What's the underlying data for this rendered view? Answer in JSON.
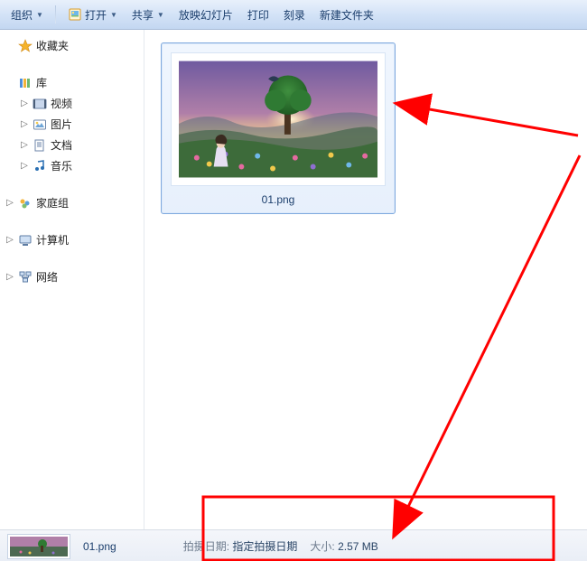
{
  "toolbar": {
    "organize": "组织",
    "open": "打开",
    "share": "共享",
    "slideshow": "放映幻灯片",
    "print": "打印",
    "burn": "刻录",
    "new_folder": "新建文件夹"
  },
  "sidebar": {
    "favorites": "收藏夹",
    "libraries": "库",
    "videos": "视频",
    "pictures": "图片",
    "documents": "文档",
    "music": "音乐",
    "homegroup": "家庭组",
    "computer": "计算机",
    "network": "网络"
  },
  "file": {
    "name": "01.png",
    "date_label": "拍摄日期:",
    "date_value": "指定拍摄日期",
    "size_label": "大小:",
    "size_value": "2.57 MB"
  },
  "colors": {
    "annotation": "#ff0000"
  }
}
